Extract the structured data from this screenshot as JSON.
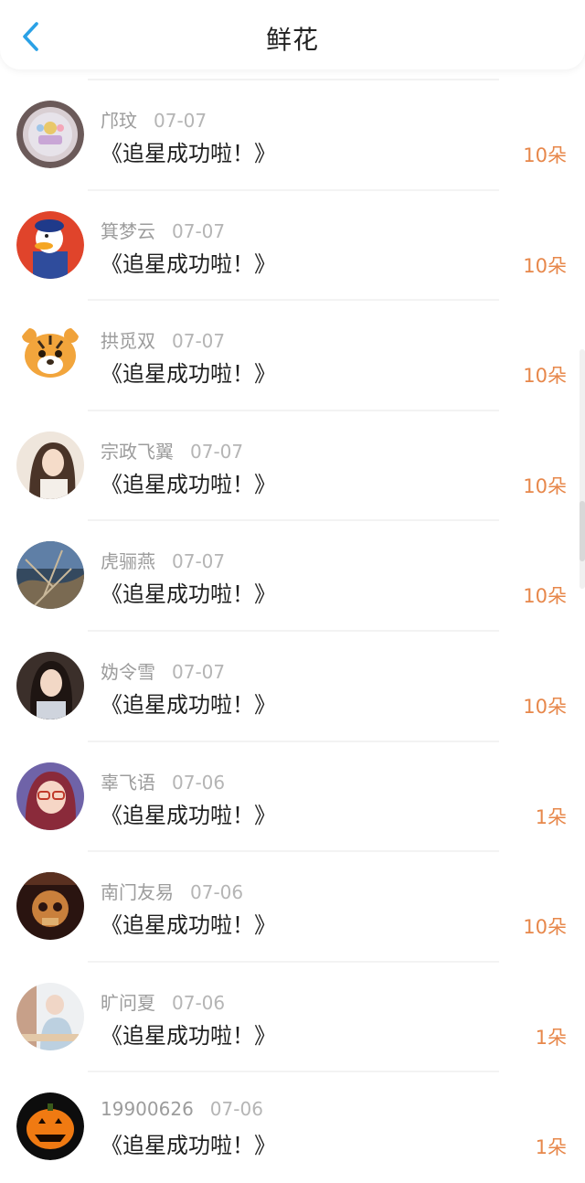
{
  "header": {
    "title": "鲜花",
    "back_icon": "chevron-left-icon",
    "accent": "#2aa1e6"
  },
  "colors": {
    "count": "#e7874a",
    "name": "#9c9c9c",
    "message": "#1f1f1f"
  },
  "items": [
    {
      "name": "邝玟",
      "date": "07-07",
      "message": "《追星成功啦！》",
      "count": "10朵",
      "avatar": "avatar-plate"
    },
    {
      "name": "箕梦云",
      "date": "07-07",
      "message": "《追星成功啦！》",
      "count": "10朵",
      "avatar": "avatar-donald"
    },
    {
      "name": "拱觅双",
      "date": "07-07",
      "message": "《追星成功啦！》",
      "count": "10朵",
      "avatar": "avatar-tiger"
    },
    {
      "name": "宗政飞翼",
      "date": "07-07",
      "message": "《追星成功啦！》",
      "count": "10朵",
      "avatar": "avatar-girl"
    },
    {
      "name": "虎骊燕",
      "date": "07-07",
      "message": "《追星成功啦！》",
      "count": "10朵",
      "avatar": "avatar-tree"
    },
    {
      "name": "妫令雪",
      "date": "07-07",
      "message": "《追星成功啦！》",
      "count": "10朵",
      "avatar": "avatar-woman"
    },
    {
      "name": "辜飞语",
      "date": "07-06",
      "message": "《追星成功啦！》",
      "count": "1朵",
      "avatar": "avatar-anime"
    },
    {
      "name": "南门友易",
      "date": "07-06",
      "message": "《追星成功啦！》",
      "count": "10朵",
      "avatar": "avatar-skull"
    },
    {
      "name": "旷问夏",
      "date": "07-06",
      "message": "《追星成功啦！》",
      "count": "1朵",
      "avatar": "avatar-photo"
    },
    {
      "name": "19900626",
      "date": "07-06",
      "message": "《追星成功啦！》",
      "count": "1朵",
      "avatar": "avatar-pumpkin"
    }
  ]
}
